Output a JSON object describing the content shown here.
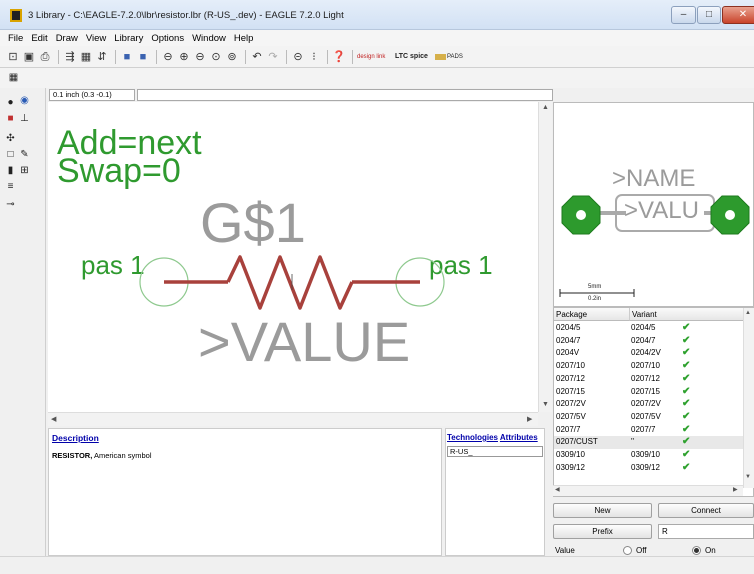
{
  "window": {
    "title": "3 Library - C:\\EAGLE-7.2.0\\lbr\\resistor.lbr (R-US_.dev) - EAGLE 7.2.0 Light",
    "minimize_label": "–",
    "maximize_label": "□",
    "close_label": "✕"
  },
  "menu": [
    "File",
    "Edit",
    "Draw",
    "View",
    "Library",
    "Options",
    "Window",
    "Help"
  ],
  "toolbar": {
    "designlink_label": "design link",
    "ltspice_label": "LTC spice",
    "pads_label": "PADS"
  },
  "coordinate_field": "0.1 inch (0.3 -0.1)",
  "canvas": {
    "add_text": "Add=next",
    "swap_text": "Swap=0",
    "gate_name": "G$1",
    "pin_left": "pas 1",
    "pin_right": "pas 1",
    "value_text": ">VALUE"
  },
  "description": {
    "link": "Description",
    "title": "RESISTOR,",
    "subtitle": "American symbol"
  },
  "technologies": {
    "header_tech": "Technologies",
    "header_attr": "Attributes",
    "row": "R-US_"
  },
  "preview": {
    "name_text": ">NAME",
    "value_text": ">VALU",
    "scale_mm": "5mm",
    "scale_in": "0.2in"
  },
  "package_table": {
    "headers": [
      "Package",
      "Variant"
    ],
    "rows": [
      {
        "package": "0204/5",
        "variant": "0204/5"
      },
      {
        "package": "0204/7",
        "variant": "0204/7"
      },
      {
        "package": "0204V",
        "variant": "0204/2V"
      },
      {
        "package": "0207/10",
        "variant": "0207/10"
      },
      {
        "package": "0207/12",
        "variant": "0207/12"
      },
      {
        "package": "0207/15",
        "variant": "0207/15"
      },
      {
        "package": "0207/2V",
        "variant": "0207/2V"
      },
      {
        "package": "0207/5V",
        "variant": "0207/5V"
      },
      {
        "package": "0207/7",
        "variant": "0207/7"
      },
      {
        "package": "0207/CUST",
        "variant": "''"
      },
      {
        "package": "0309/10",
        "variant": "0309/10"
      },
      {
        "package": "0309/12",
        "variant": "0309/12"
      }
    ]
  },
  "buttons": {
    "new": "New",
    "connect": "Connect",
    "prefix": "Prefix"
  },
  "prefix_value": "R",
  "value_row": {
    "label": "Value",
    "off_label": "Off",
    "on_label": "On",
    "selected": "On"
  },
  "colors": {
    "canvas_green": "#2f9a2f",
    "canvas_grey": "#9b9b9b",
    "resistor_red": "#a8413c",
    "pad_green": "#2d9a2d",
    "check_green": "#2ea12e"
  }
}
